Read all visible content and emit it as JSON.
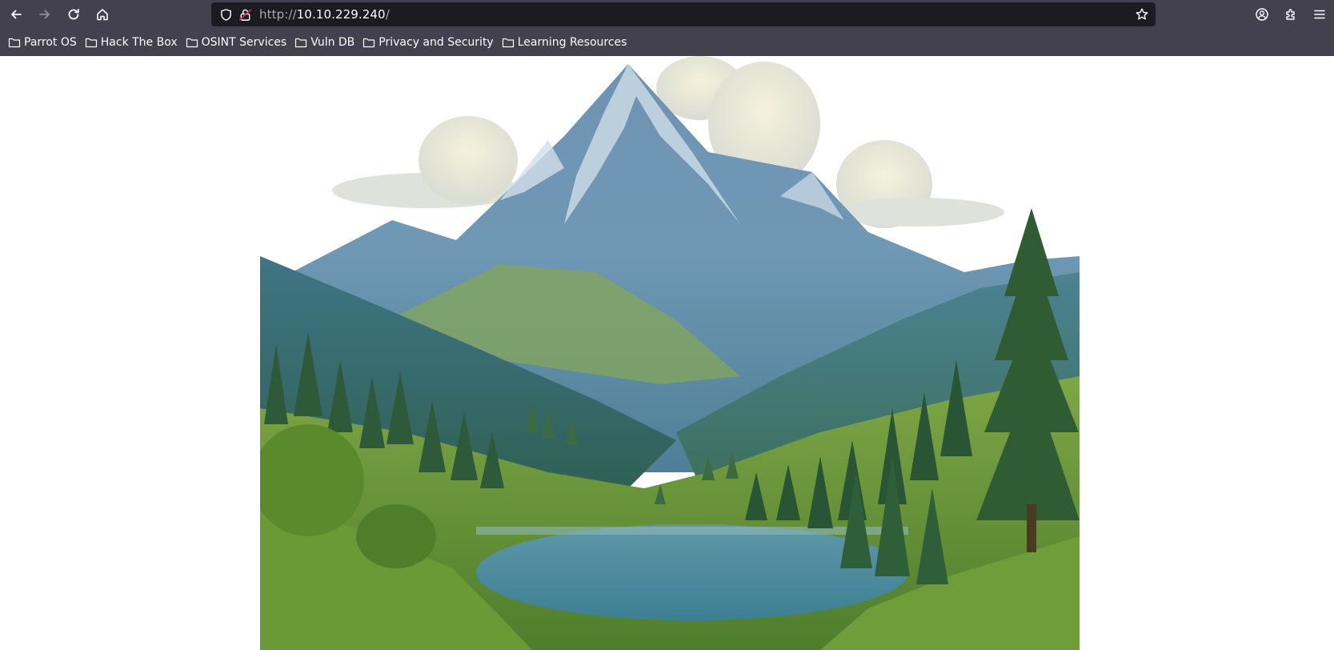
{
  "browser": {
    "url_prefix": "http://",
    "url_host": "10.10.229.240",
    "url_suffix": "/",
    "nav": {
      "back_icon": "arrow-left-icon",
      "forward_icon": "arrow-right-icon",
      "reload_icon": "reload-icon",
      "home_icon": "home-icon"
    }
  },
  "bookmarks": [
    {
      "label": "Parrot OS"
    },
    {
      "label": "Hack The Box"
    },
    {
      "label": "OSINT Services"
    },
    {
      "label": "Vuln DB"
    },
    {
      "label": "Privacy and Security"
    },
    {
      "label": "Learning Resources"
    }
  ],
  "colors": {
    "toolbar": "#42414d",
    "urlbar": "#1c1b22",
    "text": "#fbfbfe"
  }
}
